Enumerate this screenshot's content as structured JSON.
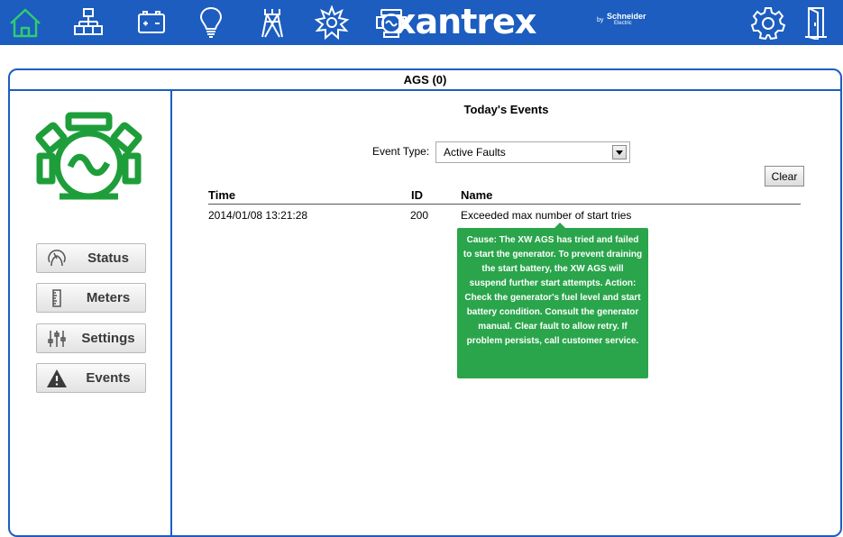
{
  "nav": {
    "icons": [
      "home-icon",
      "network-icon",
      "battery-icon",
      "lightbulb-icon",
      "tower-icon",
      "sun-icon",
      "generator-icon"
    ],
    "brand": "xantrex",
    "brand_by": "by",
    "brand_partner": "Schneider",
    "brand_partner_sub": "Electric",
    "right_icons": [
      "gear-icon",
      "exit-door-icon"
    ],
    "home_color": "#2ecc71",
    "bar_color": "#1c5dbf"
  },
  "panel": {
    "title": "AGS (0)"
  },
  "sidebar": {
    "logo_icon": "generator-logo-icon",
    "logo_color": "#1e9e3a",
    "buttons": [
      {
        "label": "Status",
        "icon": "gauge-icon"
      },
      {
        "label": "Meters",
        "icon": "meter-icon"
      },
      {
        "label": "Settings",
        "icon": "sliders-icon"
      },
      {
        "label": "Events",
        "icon": "warning-icon"
      }
    ]
  },
  "events": {
    "title": "Today's Events",
    "event_type_label": "Event Type:",
    "event_type_value": "Active Faults",
    "clear_label": "Clear",
    "columns": [
      "Time",
      "ID",
      "Name"
    ],
    "rows": [
      {
        "time": "2014/01/08 13:21:28",
        "id": "200",
        "name": "Exceeded max number of start tries"
      }
    ],
    "tooltip": "Cause: The XW AGS has tried and failed to start the generator. To prevent draining the start battery, the XW AGS will suspend further start attempts. Action: Check the generator's fuel level and start battery condition. Consult the generator manual. Clear fault to allow retry. If problem persists, call customer service.",
    "tooltip_color": "#2aa54b"
  }
}
